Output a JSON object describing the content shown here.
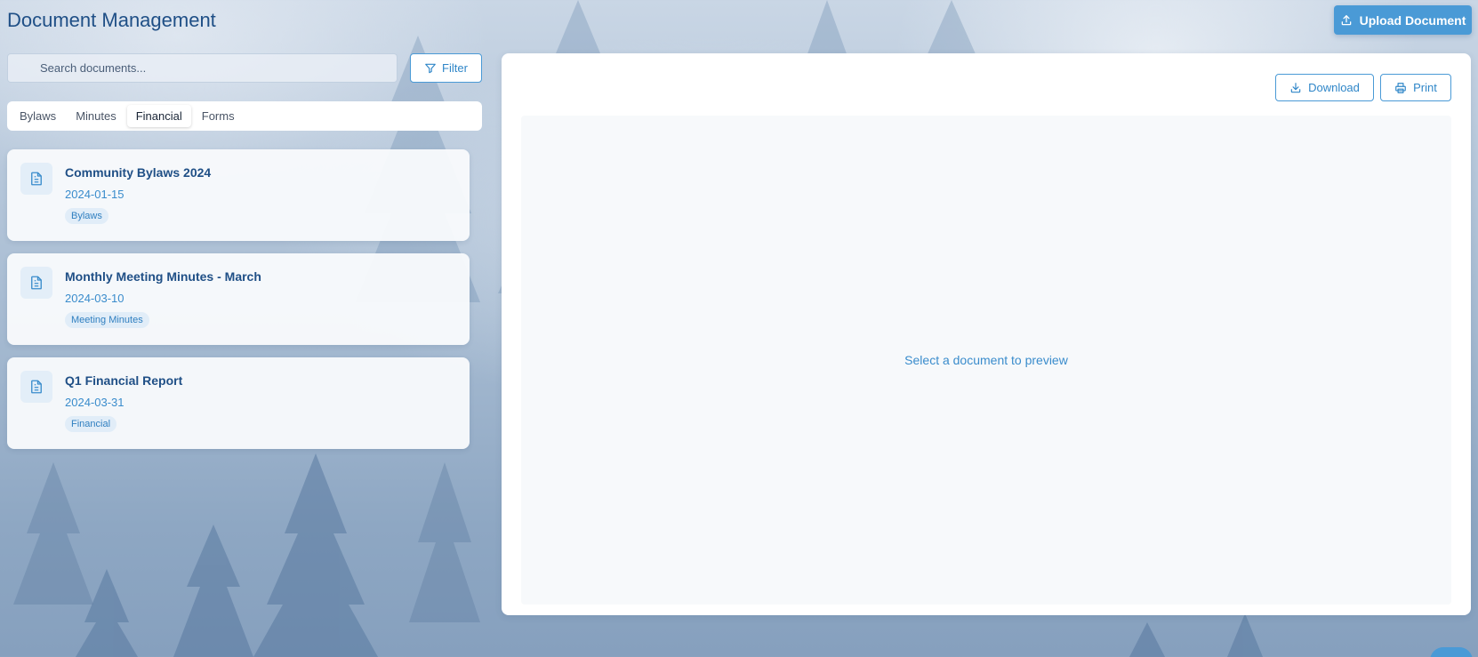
{
  "header": {
    "title": "Document Management",
    "upload_label": "Upload Document",
    "upload_icon": "upload-icon"
  },
  "search": {
    "placeholder": "Search documents...",
    "value": "",
    "icon": "search-icon"
  },
  "filter": {
    "label": "Filter",
    "icon": "filter-icon"
  },
  "tabs": [
    {
      "label": "Bylaws",
      "active": false
    },
    {
      "label": "Minutes",
      "active": false
    },
    {
      "label": "Financial",
      "active": true
    },
    {
      "label": "Forms",
      "active": false
    }
  ],
  "documents": [
    {
      "title": "Community Bylaws 2024",
      "date": "2024-01-15",
      "tag": "Bylaws",
      "icon": "document-icon"
    },
    {
      "title": "Monthly Meeting Minutes - March",
      "date": "2024-03-10",
      "tag": "Meeting Minutes",
      "icon": "document-icon"
    },
    {
      "title": "Q1 Financial Report",
      "date": "2024-03-31",
      "tag": "Financial",
      "icon": "document-icon"
    }
  ],
  "preview": {
    "download_label": "Download",
    "print_label": "Print",
    "empty_message": "Select a document to preview"
  },
  "colors": {
    "accent": "#4a9ad6",
    "title": "#1f4f86",
    "tag_bg": "#e1edf8"
  }
}
